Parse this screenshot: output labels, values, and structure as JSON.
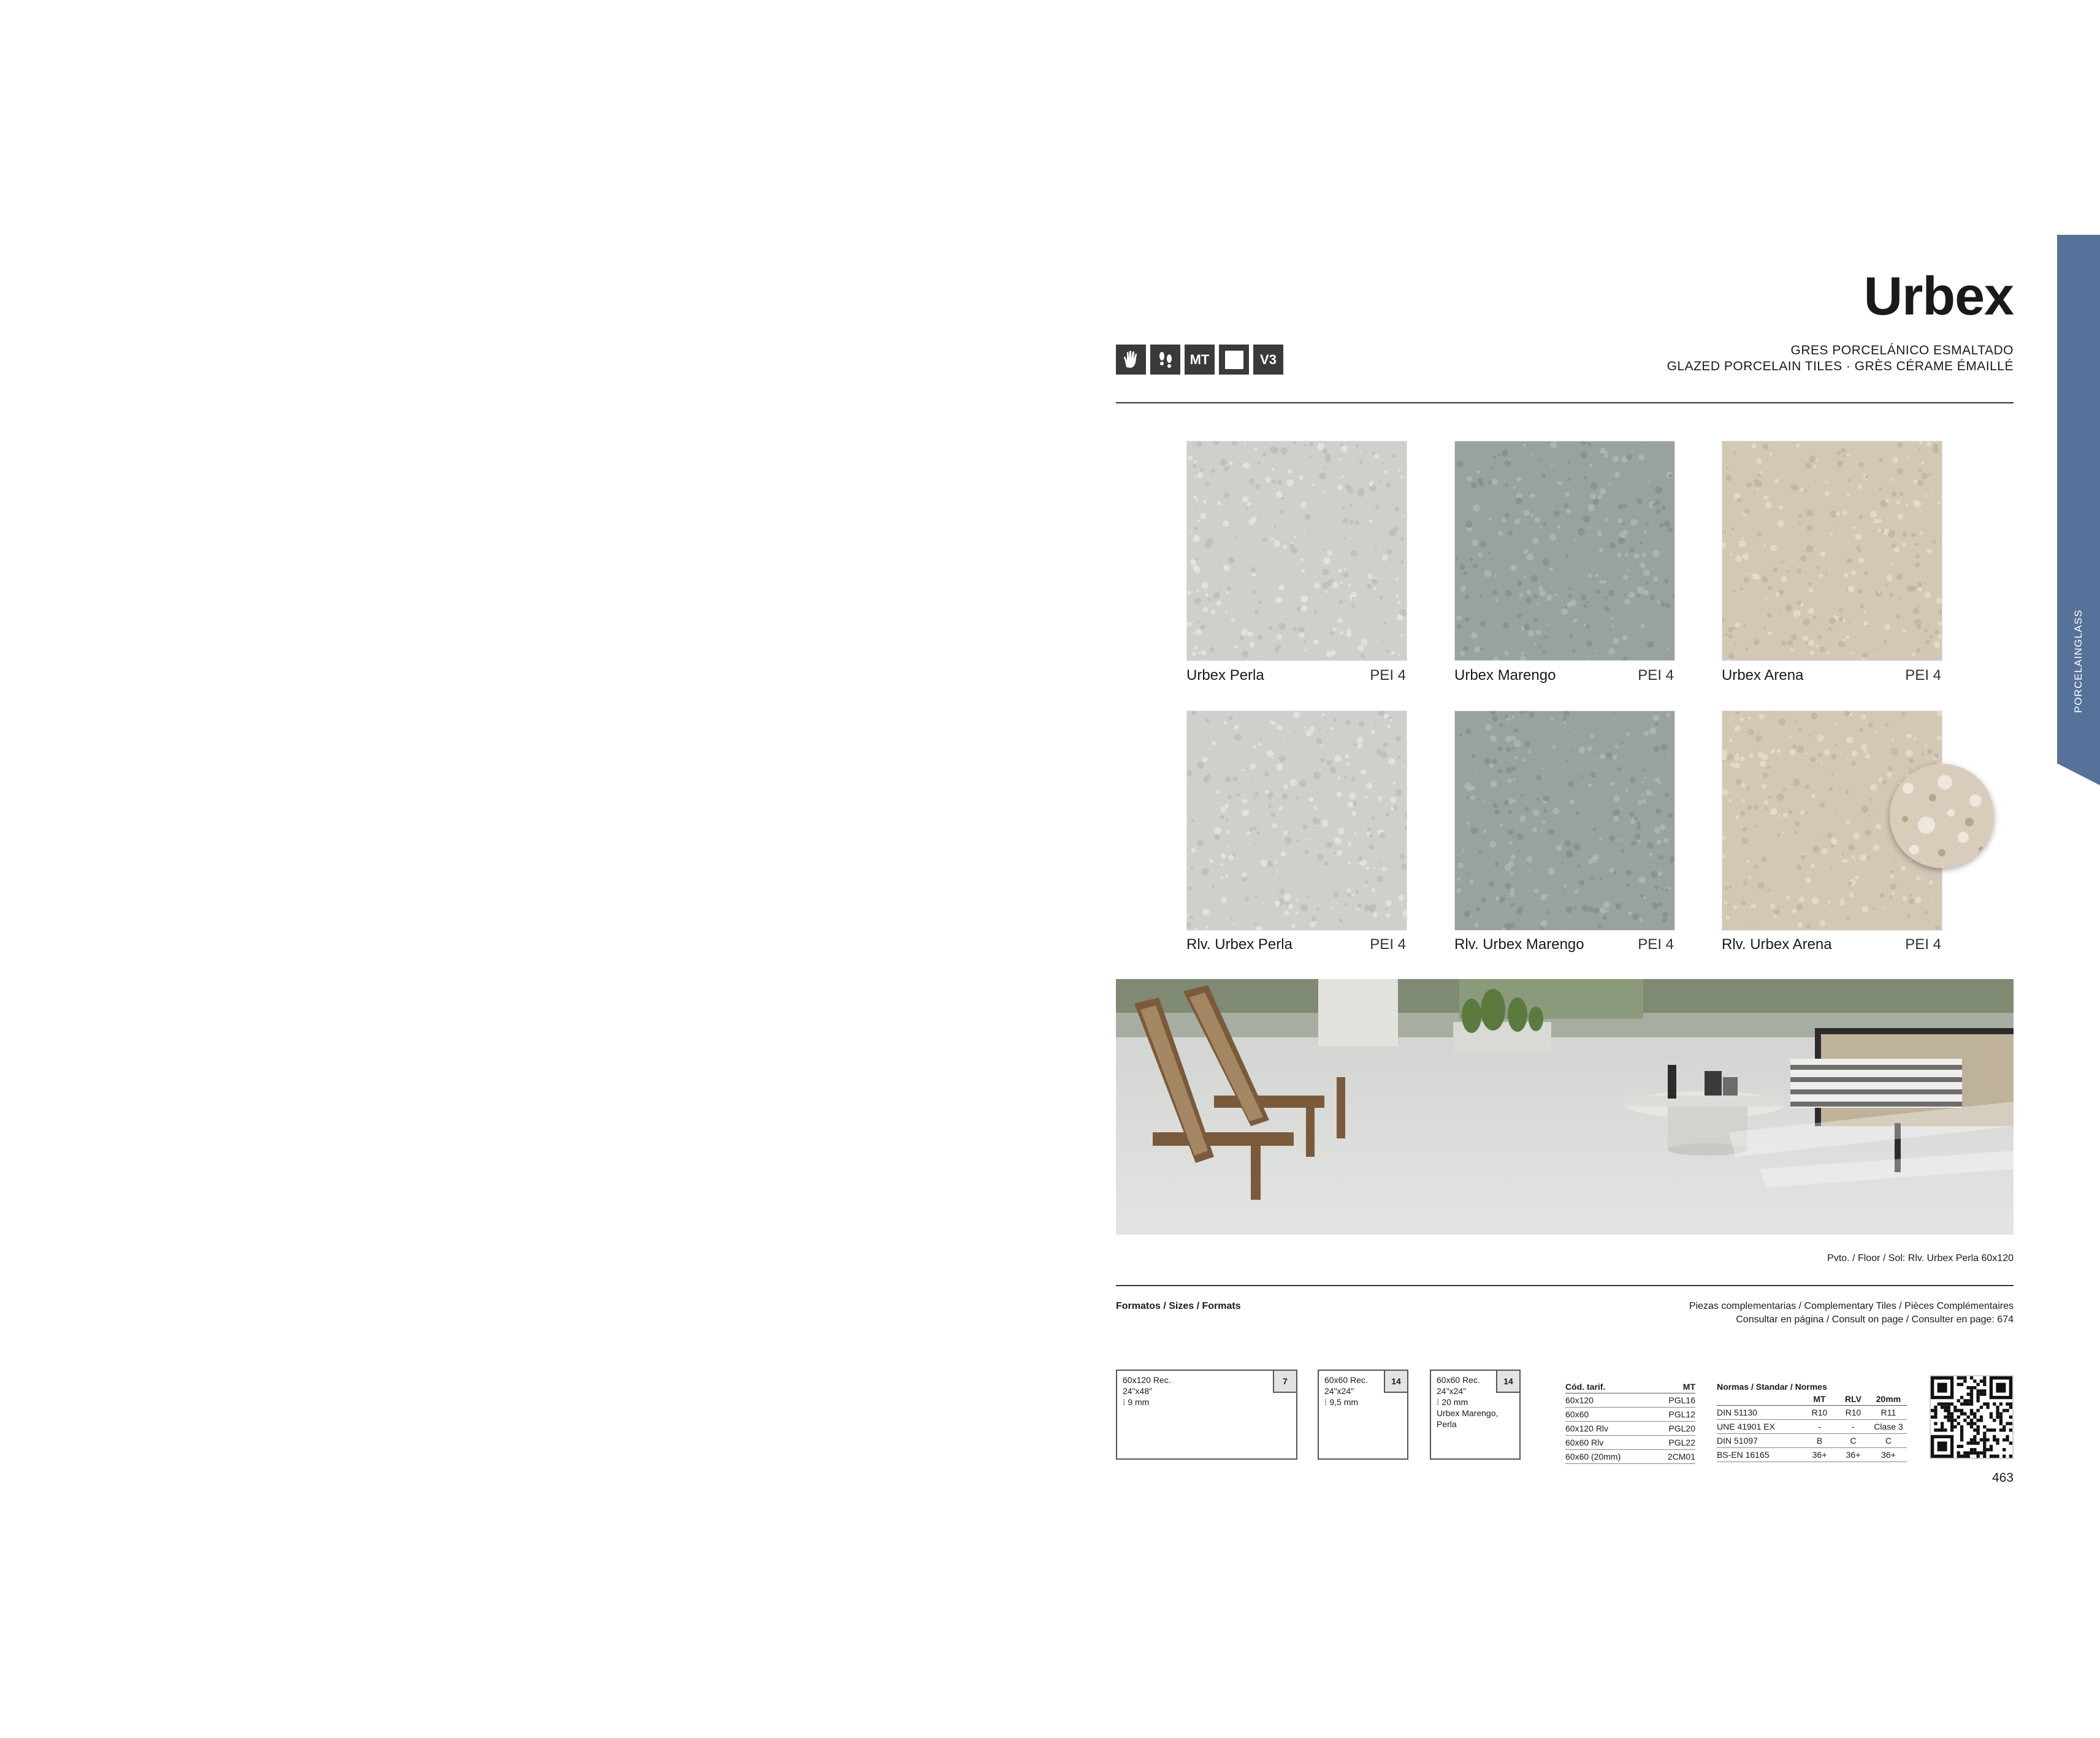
{
  "side_tab": {
    "label": "PORCELAINGLASS",
    "color": "#57729a"
  },
  "header": {
    "title": "Urbex",
    "subtitle_1": "GRES PORCELÁNICO ESMALTADO",
    "subtitle_2": "GLAZED PORCELAIN TILES · GRÈS CÉRAME ÉMAILLÉ",
    "icons": [
      {
        "name": "hand-icon",
        "text": ""
      },
      {
        "name": "footprints-icon",
        "text": ""
      },
      {
        "name": "matt-icon",
        "text": "MT"
      },
      {
        "name": "square-icon",
        "text": ""
      },
      {
        "name": "v3-icon",
        "text": "V3"
      }
    ]
  },
  "tiles": [
    {
      "name": "Urbex Perla",
      "pei": "PEI 4",
      "color": "#cfcfcc"
    },
    {
      "name": "Urbex Marengo",
      "pei": "PEI 4",
      "color": "#98a39d"
    },
    {
      "name": "Urbex Arena",
      "pei": "PEI 4",
      "color": "#d3c7b6"
    },
    {
      "name": "Rlv. Urbex Perla",
      "pei": "PEI 4",
      "color": "#cfcfcc"
    },
    {
      "name": "Rlv. Urbex Marengo",
      "pei": "PEI 4",
      "color": "#98a39d"
    },
    {
      "name": "Rlv. Urbex Arena",
      "pei": "PEI 4",
      "color": "#d3c7b6"
    }
  ],
  "photo_caption": "Pvto. / Floor / Sol: Rlv. Urbex Perla 60x120",
  "formats": {
    "label": "Formatos / Sizes / Formats",
    "complementary_1": "Piezas complementarias / Complementary Tiles / Pièces Complémentaires",
    "complementary_2": "Consultar en página / Consult on page / Consulter en page: 674",
    "boxes": [
      {
        "line1": "60x120 Rec.",
        "line2": "24\"x48\"",
        "line3": "⁝ 9 mm",
        "line4": "",
        "line5": "",
        "count": "7"
      },
      {
        "line1": "60x60 Rec.",
        "line2": "24\"x24\"",
        "line3": "⁝ 9,5 mm",
        "line4": "",
        "line5": "",
        "count": "14"
      },
      {
        "line1": "60x60 Rec.",
        "line2": "24\"x24\"",
        "line3": "⁝ 20 mm",
        "line4": "Urbex Marengo,",
        "line5": "Perla",
        "count": "14"
      }
    ]
  },
  "codes_table": {
    "headers": [
      "Cód. tarif.",
      "MT"
    ],
    "rows": [
      [
        "60x120",
        "PGL16"
      ],
      [
        "60x60",
        "PGL12"
      ],
      [
        "60x120 Rlv",
        "PGL20"
      ],
      [
        "60x60 Rlv",
        "PGL22"
      ],
      [
        "60x60 (20mm)",
        "2CM01"
      ]
    ]
  },
  "norms_table": {
    "title": "Normas / Standar / Normes",
    "headers": [
      "",
      "MT",
      "RLV",
      "20mm"
    ],
    "rows": [
      [
        "DIN 51130",
        "R10",
        "R10",
        "R11"
      ],
      [
        "UNE 41901 EX",
        "-",
        "-",
        "Clase 3"
      ],
      [
        "DIN 51097",
        "B",
        "C",
        "C"
      ],
      [
        "BS-EN 16165",
        "36+",
        "36+",
        "36+"
      ]
    ]
  },
  "page_number": "463"
}
